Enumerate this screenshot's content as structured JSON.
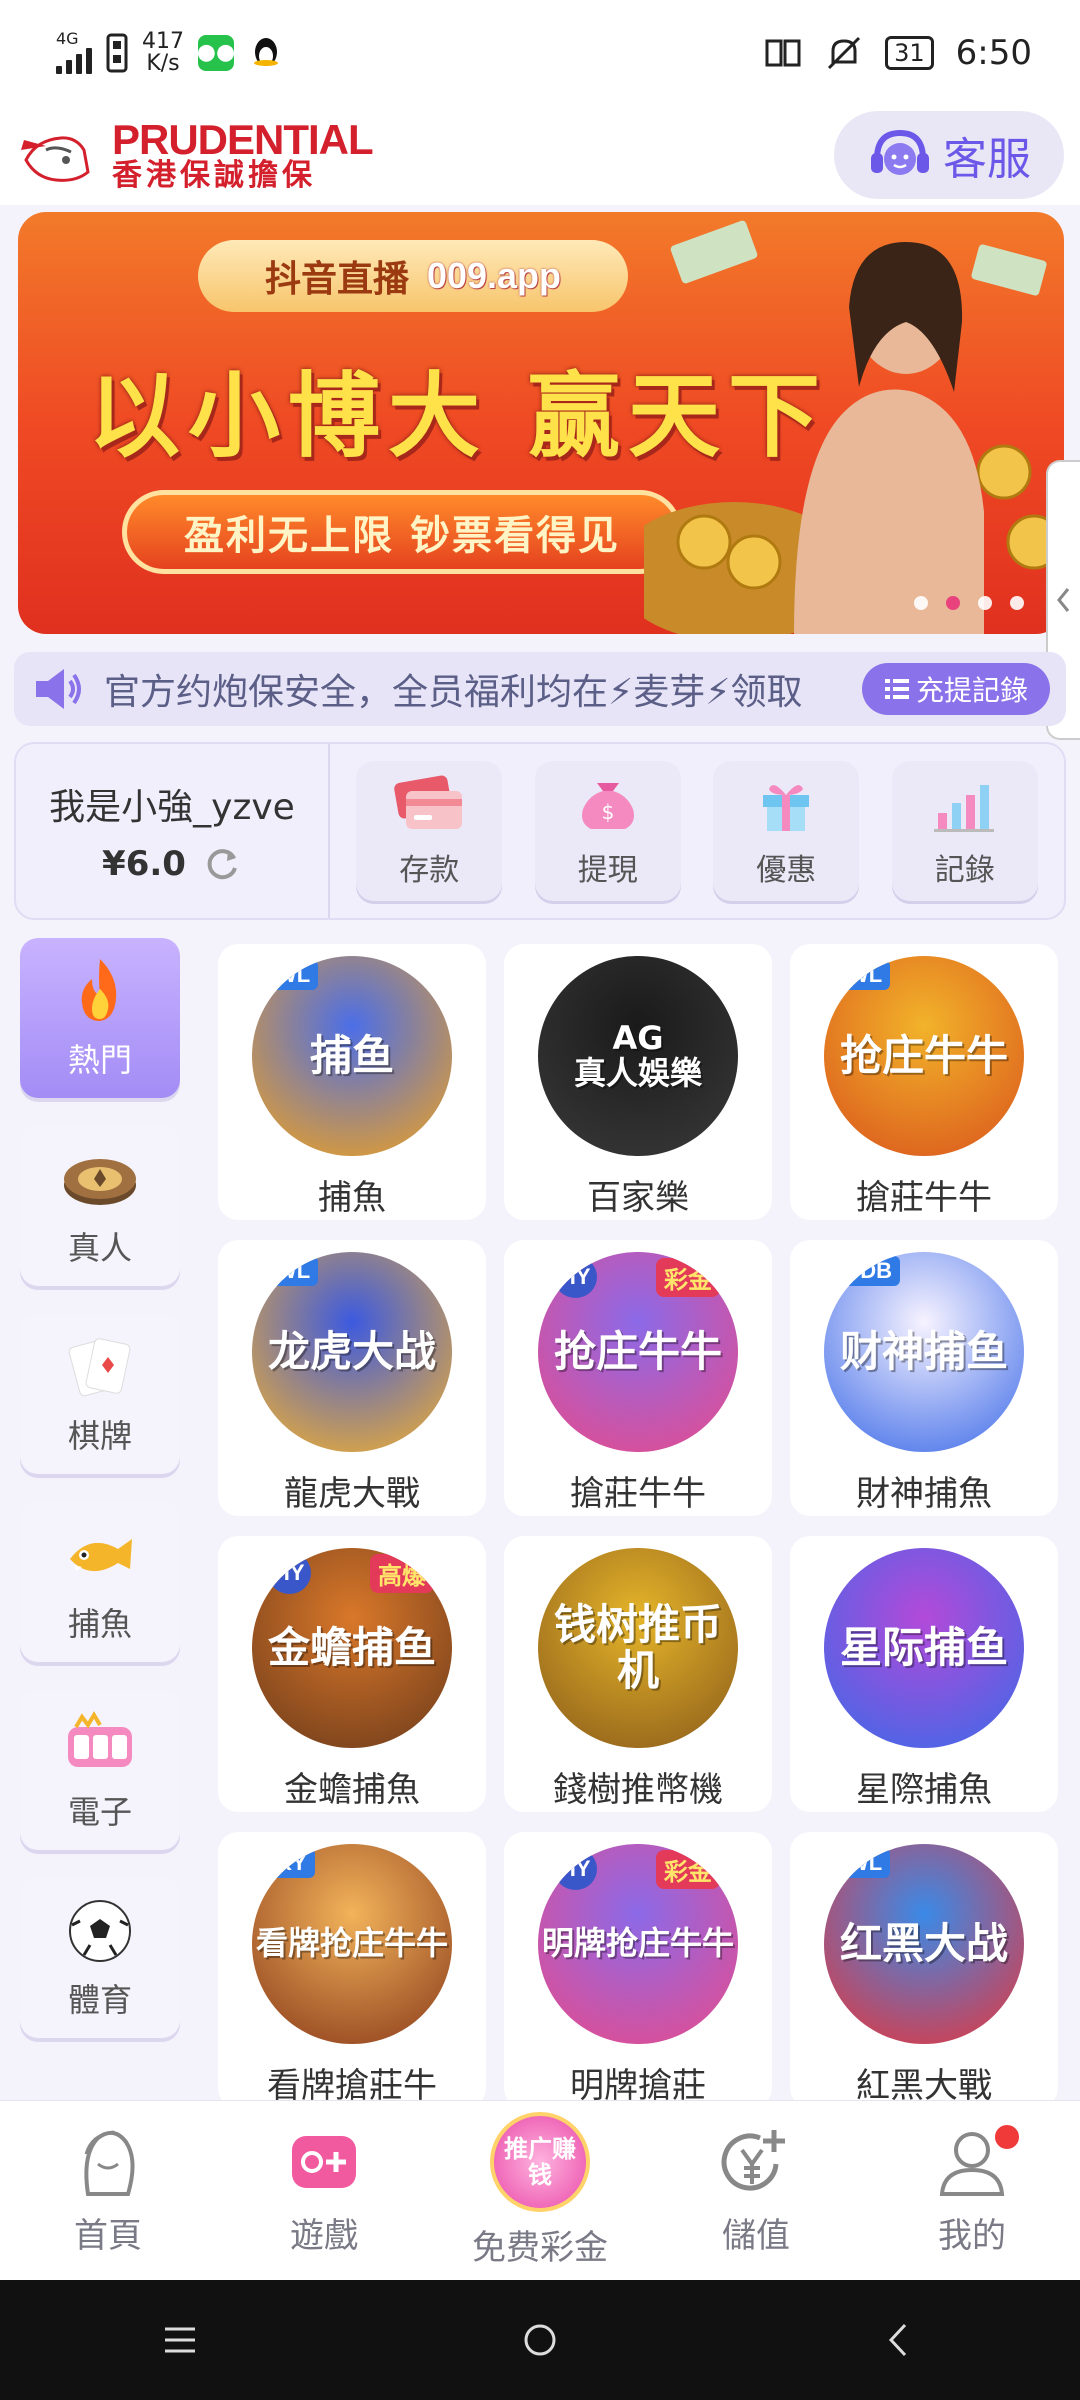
{
  "status_bar": {
    "network": "4G",
    "net_speed_value": "417",
    "net_speed_unit": "K/s",
    "battery": "31",
    "time": "6:50"
  },
  "header": {
    "logo_en": "PRUDENTIAL",
    "logo_zh": "香港保誠擔保",
    "customer_service_label": "客服"
  },
  "banner": {
    "top_label": "抖音直播",
    "top_url": "009.app",
    "headline": "以小博大 赢天下",
    "pill_text": "盈利无上限 钞票看得见",
    "slide_count": 4,
    "active_slide": 2
  },
  "notice": {
    "text": "官方约炮保安全，全员福利均在⚡麦芽⚡领取",
    "button_label": "充提記錄"
  },
  "account": {
    "username": "我是小強_yzve",
    "balance": "¥6.0",
    "actions": [
      {
        "label": "存款",
        "icon": "card-icon"
      },
      {
        "label": "提現",
        "icon": "money-bag-icon"
      },
      {
        "label": "優惠",
        "icon": "gift-icon"
      },
      {
        "label": "記錄",
        "icon": "bar-chart-icon"
      }
    ]
  },
  "categories": [
    {
      "label": "熱門",
      "icon": "flame-icon",
      "active": true
    },
    {
      "label": "真人",
      "icon": "chip-icon",
      "active": false
    },
    {
      "label": "棋牌",
      "icon": "cards-icon",
      "active": false
    },
    {
      "label": "捕魚",
      "icon": "fish-icon",
      "active": false
    },
    {
      "label": "電子",
      "icon": "slot-icon",
      "active": false
    },
    {
      "label": "體育",
      "icon": "soccer-icon",
      "active": false
    }
  ],
  "games": [
    {
      "name": "捕魚",
      "art_text": "捕鱼",
      "badge": "WL",
      "colors": [
        "#4b6ee8",
        "#f2a21b"
      ]
    },
    {
      "name": "百家樂",
      "art_text": "AG\n真人娛樂",
      "badge": "",
      "colors": [
        "#1a1a1a",
        "#3a3a3a"
      ]
    },
    {
      "name": "搶莊牛牛",
      "art_text": "抢庄牛牛",
      "badge": "WL",
      "colors": [
        "#f2b32a",
        "#d9541c"
      ]
    },
    {
      "name": "龍虎大戰",
      "art_text": "龙虎大战",
      "badge": "WL",
      "colors": [
        "#3c5ae0",
        "#f6b22a"
      ]
    },
    {
      "name": "搶莊牛牛",
      "art_text": "抢庄牛牛",
      "badge": "HY",
      "colors": [
        "#8c6ae8",
        "#e84a8a"
      ],
      "gold": "彩金"
    },
    {
      "name": "財神捕魚",
      "art_text": "财神捕鱼",
      "badge": "JDB",
      "colors": [
        "#f7f3ff",
        "#3c6ae8"
      ]
    },
    {
      "name": "金蟾捕魚",
      "art_text": "金蟾捕鱼",
      "badge": "HY",
      "colors": [
        "#d9782a",
        "#6c3a1a"
      ],
      "gold": "高爆"
    },
    {
      "name": "錢樹推幣機",
      "art_text": "钱树推币机",
      "badge": "",
      "colors": [
        "#e5b52a",
        "#8a5a1a"
      ]
    },
    {
      "name": "星際捕魚",
      "art_text": "星际捕鱼",
      "badge": "",
      "colors": [
        "#b34ad9",
        "#3a6ae8"
      ]
    },
    {
      "name": "看牌搶莊牛",
      "art_text": "看牌抢庄牛牛",
      "badge": "KY",
      "colors": [
        "#f2b35a",
        "#8a3a1a"
      ]
    },
    {
      "name": "明牌搶莊",
      "art_text": "明牌抢庄牛牛",
      "badge": "HY",
      "colors": [
        "#8c6ae8",
        "#e84a8a"
      ],
      "gold": "彩金"
    },
    {
      "name": "紅黑大戰",
      "art_text": "红黑大战",
      "badge": "WL",
      "colors": [
        "#3a8ae8",
        "#e8343a"
      ]
    }
  ],
  "bottom_nav": [
    {
      "label": "首頁",
      "icon": "home-portrait-icon"
    },
    {
      "label": "遊戲",
      "icon": "gamepad-icon"
    },
    {
      "label": "免费彩金",
      "icon": "promo-icon",
      "promo_text": "推广赚钱"
    },
    {
      "label": "儲值",
      "icon": "yen-plus-icon"
    },
    {
      "label": "我的",
      "icon": "user-icon",
      "notification": true
    }
  ],
  "colors": {
    "accent": "#8a72ea",
    "page_bg": "#f4f3fb",
    "logo_red": "#d4202c"
  }
}
